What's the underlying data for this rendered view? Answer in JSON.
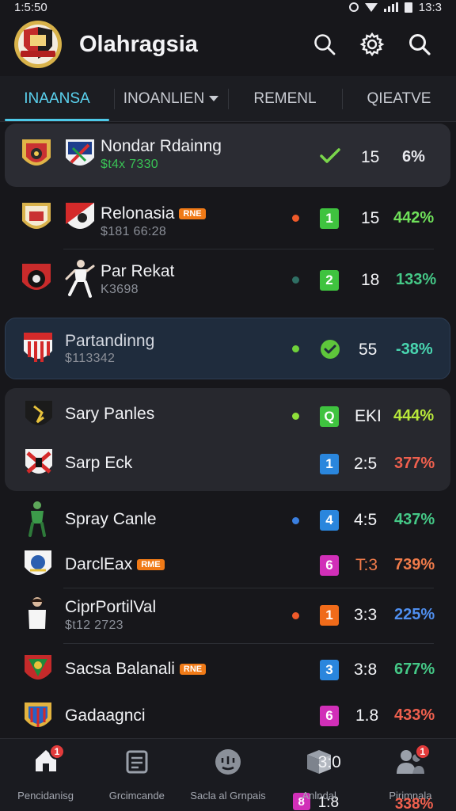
{
  "status": {
    "time": "1:5:50",
    "right": "13:3"
  },
  "app": {
    "title": "Olahragsia"
  },
  "tabs": [
    {
      "label": "INAANSA"
    },
    {
      "label": "INOANLIEN"
    },
    {
      "label": "REMENL"
    },
    {
      "label": "QIEATVE"
    }
  ],
  "rows": [
    {
      "name": "Nondar Rdainng",
      "sub": "$t4x 7330",
      "sub_green": true,
      "indicator": "check",
      "score": "15",
      "pct": "6%",
      "pct_color": "#e8e9ee"
    },
    {
      "name": "Relonasia",
      "tag": "RNE",
      "sub": "$181 66:28",
      "indicator": "1",
      "badge_color": "#3fc33f",
      "dot_color": "#ef5a2a",
      "score": "15",
      "pct": "442%",
      "pct_color": "#6fe05a"
    },
    {
      "name": "Par Rekat",
      "sub": "K3698",
      "indicator": "2",
      "badge_color": "#3fc33f",
      "dot_color": "#2f6f64",
      "score": "18",
      "pct": "133%",
      "pct_color": "#45c987"
    },
    {
      "name": "Partandinng",
      "sub": "$113342",
      "indicator": "heart-check",
      "dot_color": "#6fd13b",
      "score": "55",
      "pct": "-38%",
      "pct_color": "#49d6b0"
    },
    {
      "name": "Sary Panles",
      "indicator": "Q",
      "badge_color": "#3fc33f",
      "dot_color": "#8fe03a",
      "score": "EKI",
      "pct": "444%",
      "pct_color": "#b8e83a"
    },
    {
      "name": "Sarp Eck",
      "indicator": "1",
      "badge_color": "#2a86dd",
      "score": "2:5",
      "pct": "377%",
      "pct_color": "#f0604e"
    },
    {
      "name": "Spray Canle",
      "indicator": "4",
      "badge_color": "#2a86dd",
      "dot_color": "#3a7fe0",
      "score": "4:5",
      "pct": "437%",
      "pct_color": "#45c987"
    },
    {
      "name": "DarclEax",
      "tag": "RME",
      "indicator": "6",
      "badge_color": "#d12fb8",
      "score": "T:3",
      "pct": "739%",
      "pct_color": "#f07b4a"
    },
    {
      "name": "CiprPortilVal",
      "sub": "$t12 2723",
      "indicator": "1",
      "badge_color": "#f06b1a",
      "dot_color": "#ef5a2a",
      "score": "3:3",
      "pct": "225%",
      "pct_color": "#4f8ff0"
    },
    {
      "name": "Sacsa Balanali",
      "tag": "RNE",
      "indicator": "3",
      "badge_color": "#2a86dd",
      "score": "3:8",
      "pct": "677%",
      "pct_color": "#45c987"
    },
    {
      "name": "Gadaagnci",
      "indicator": "6",
      "badge_color": "#d12fb8",
      "score": "1.8",
      "pct": "433%",
      "pct_color": "#f0604e"
    }
  ],
  "nav": [
    {
      "label": "Pencidanisg",
      "badge": "1"
    },
    {
      "label": "Grcimcande"
    },
    {
      "label": "Sacla al Grnpais"
    },
    {
      "label": "Anlndal",
      "score": "3:0",
      "badge_num": "8",
      "score2": "1:8"
    },
    {
      "label": "Pirimnala",
      "badge": "1",
      "pct": "338%"
    }
  ],
  "colors": {
    "accent": "#4ec9e8",
    "background": "#17171b"
  }
}
